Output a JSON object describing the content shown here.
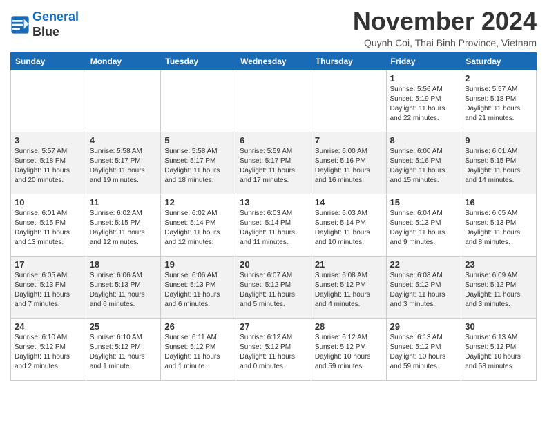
{
  "header": {
    "logo_line1": "General",
    "logo_line2": "Blue",
    "title": "November 2024",
    "location": "Quynh Coi, Thai Binh Province, Vietnam"
  },
  "days_of_week": [
    "Sunday",
    "Monday",
    "Tuesday",
    "Wednesday",
    "Thursday",
    "Friday",
    "Saturday"
  ],
  "weeks": [
    [
      {
        "day": "",
        "info": ""
      },
      {
        "day": "",
        "info": ""
      },
      {
        "day": "",
        "info": ""
      },
      {
        "day": "",
        "info": ""
      },
      {
        "day": "",
        "info": ""
      },
      {
        "day": "1",
        "info": "Sunrise: 5:56 AM\nSunset: 5:19 PM\nDaylight: 11 hours\nand 22 minutes."
      },
      {
        "day": "2",
        "info": "Sunrise: 5:57 AM\nSunset: 5:18 PM\nDaylight: 11 hours\nand 21 minutes."
      }
    ],
    [
      {
        "day": "3",
        "info": "Sunrise: 5:57 AM\nSunset: 5:18 PM\nDaylight: 11 hours\nand 20 minutes."
      },
      {
        "day": "4",
        "info": "Sunrise: 5:58 AM\nSunset: 5:17 PM\nDaylight: 11 hours\nand 19 minutes."
      },
      {
        "day": "5",
        "info": "Sunrise: 5:58 AM\nSunset: 5:17 PM\nDaylight: 11 hours\nand 18 minutes."
      },
      {
        "day": "6",
        "info": "Sunrise: 5:59 AM\nSunset: 5:17 PM\nDaylight: 11 hours\nand 17 minutes."
      },
      {
        "day": "7",
        "info": "Sunrise: 6:00 AM\nSunset: 5:16 PM\nDaylight: 11 hours\nand 16 minutes."
      },
      {
        "day": "8",
        "info": "Sunrise: 6:00 AM\nSunset: 5:16 PM\nDaylight: 11 hours\nand 15 minutes."
      },
      {
        "day": "9",
        "info": "Sunrise: 6:01 AM\nSunset: 5:15 PM\nDaylight: 11 hours\nand 14 minutes."
      }
    ],
    [
      {
        "day": "10",
        "info": "Sunrise: 6:01 AM\nSunset: 5:15 PM\nDaylight: 11 hours\nand 13 minutes."
      },
      {
        "day": "11",
        "info": "Sunrise: 6:02 AM\nSunset: 5:15 PM\nDaylight: 11 hours\nand 12 minutes."
      },
      {
        "day": "12",
        "info": "Sunrise: 6:02 AM\nSunset: 5:14 PM\nDaylight: 11 hours\nand 12 minutes."
      },
      {
        "day": "13",
        "info": "Sunrise: 6:03 AM\nSunset: 5:14 PM\nDaylight: 11 hours\nand 11 minutes."
      },
      {
        "day": "14",
        "info": "Sunrise: 6:03 AM\nSunset: 5:14 PM\nDaylight: 11 hours\nand 10 minutes."
      },
      {
        "day": "15",
        "info": "Sunrise: 6:04 AM\nSunset: 5:13 PM\nDaylight: 11 hours\nand 9 minutes."
      },
      {
        "day": "16",
        "info": "Sunrise: 6:05 AM\nSunset: 5:13 PM\nDaylight: 11 hours\nand 8 minutes."
      }
    ],
    [
      {
        "day": "17",
        "info": "Sunrise: 6:05 AM\nSunset: 5:13 PM\nDaylight: 11 hours\nand 7 minutes."
      },
      {
        "day": "18",
        "info": "Sunrise: 6:06 AM\nSunset: 5:13 PM\nDaylight: 11 hours\nand 6 minutes."
      },
      {
        "day": "19",
        "info": "Sunrise: 6:06 AM\nSunset: 5:13 PM\nDaylight: 11 hours\nand 6 minutes."
      },
      {
        "day": "20",
        "info": "Sunrise: 6:07 AM\nSunset: 5:12 PM\nDaylight: 11 hours\nand 5 minutes."
      },
      {
        "day": "21",
        "info": "Sunrise: 6:08 AM\nSunset: 5:12 PM\nDaylight: 11 hours\nand 4 minutes."
      },
      {
        "day": "22",
        "info": "Sunrise: 6:08 AM\nSunset: 5:12 PM\nDaylight: 11 hours\nand 3 minutes."
      },
      {
        "day": "23",
        "info": "Sunrise: 6:09 AM\nSunset: 5:12 PM\nDaylight: 11 hours\nand 3 minutes."
      }
    ],
    [
      {
        "day": "24",
        "info": "Sunrise: 6:10 AM\nSunset: 5:12 PM\nDaylight: 11 hours\nand 2 minutes."
      },
      {
        "day": "25",
        "info": "Sunrise: 6:10 AM\nSunset: 5:12 PM\nDaylight: 11 hours\nand 1 minute."
      },
      {
        "day": "26",
        "info": "Sunrise: 6:11 AM\nSunset: 5:12 PM\nDaylight: 11 hours\nand 1 minute."
      },
      {
        "day": "27",
        "info": "Sunrise: 6:12 AM\nSunset: 5:12 PM\nDaylight: 11 hours\nand 0 minutes."
      },
      {
        "day": "28",
        "info": "Sunrise: 6:12 AM\nSunset: 5:12 PM\nDaylight: 10 hours\nand 59 minutes."
      },
      {
        "day": "29",
        "info": "Sunrise: 6:13 AM\nSunset: 5:12 PM\nDaylight: 10 hours\nand 59 minutes."
      },
      {
        "day": "30",
        "info": "Sunrise: 6:13 AM\nSunset: 5:12 PM\nDaylight: 10 hours\nand 58 minutes."
      }
    ]
  ]
}
